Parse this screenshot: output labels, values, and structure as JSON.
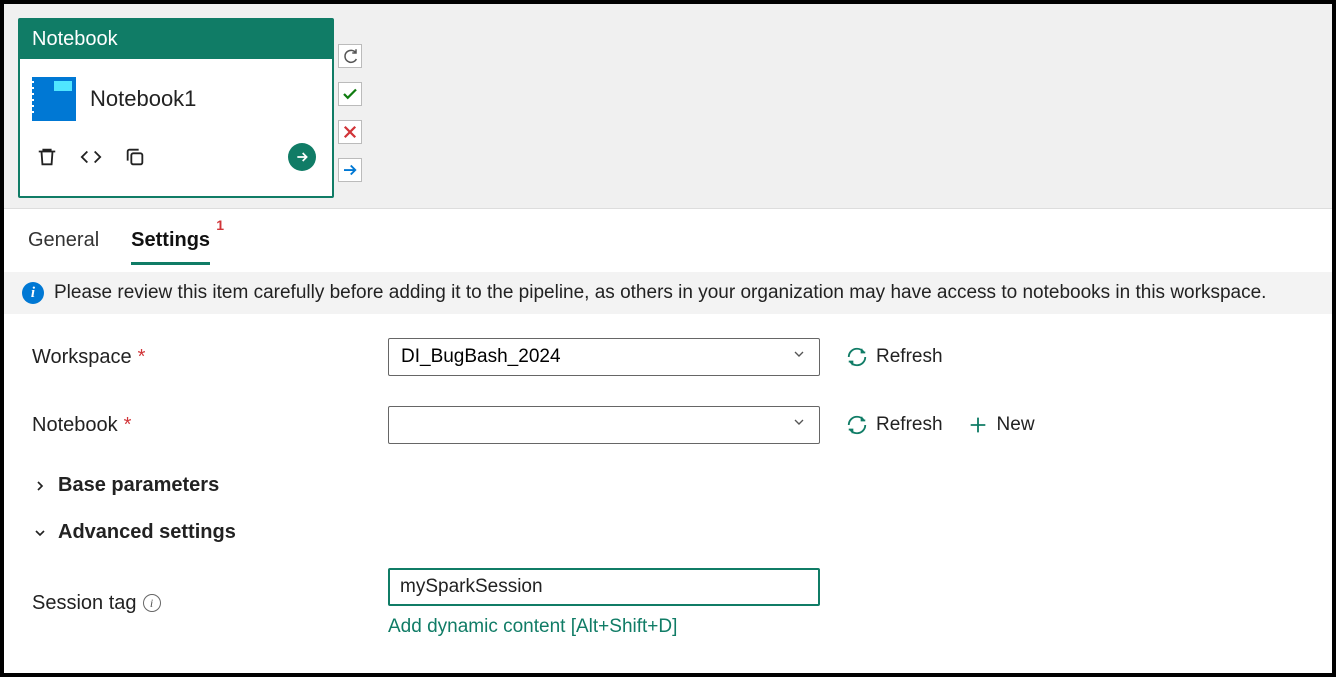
{
  "card": {
    "header": "Notebook",
    "title": "Notebook1"
  },
  "tabs": {
    "general": "General",
    "settings": "Settings",
    "badge": "1"
  },
  "info_bar": "Please review this item carefully before adding it to the pipeline, as others in your organization may have access to notebooks in this workspace.",
  "form": {
    "workspace_label": "Workspace",
    "workspace_value": "DI_BugBash_2024",
    "notebook_label": "Notebook",
    "notebook_value": "",
    "refresh": "Refresh",
    "new": "New",
    "base_params": "Base parameters",
    "advanced": "Advanced settings",
    "session_tag_label": "Session tag",
    "session_tag_value": "mySparkSession",
    "dynamic_link": "Add dynamic content [Alt+Shift+D]"
  }
}
